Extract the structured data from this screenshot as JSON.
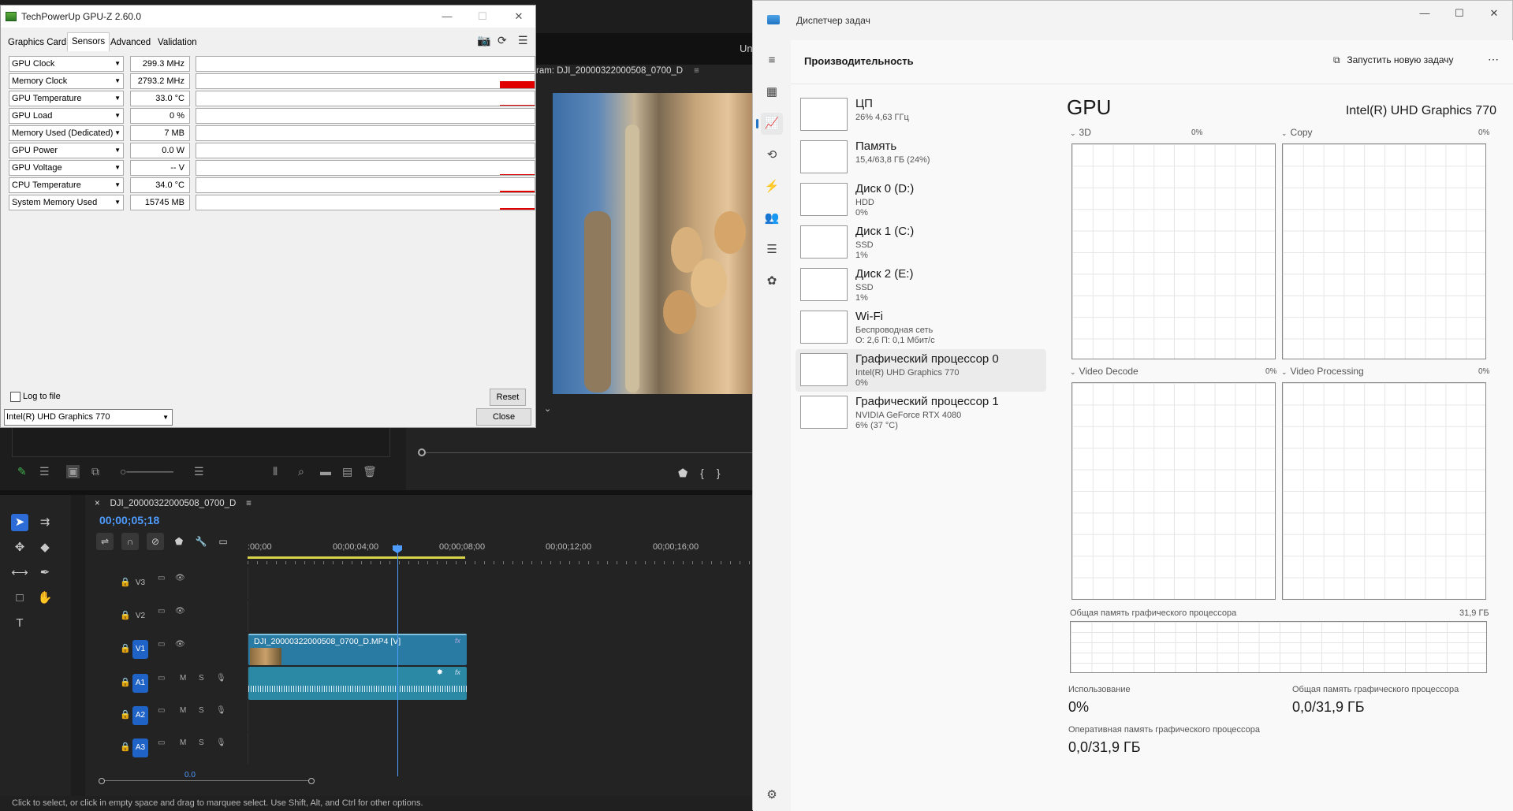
{
  "premiere": {
    "top_label": "Un",
    "program_tab": "ram: DJI_20000322000508_0700_D",
    "program_menu": "≡",
    "sequence_tab": "DJI_20000322000508_0700_D",
    "sequence_close": "×",
    "sequence_menu": "≡",
    "timecode": "00;00;05;18",
    "ruler_ticks": [
      ":00;00",
      "00;00;04;00",
      "00;00;08;00",
      "00;00;12;00",
      "00;00;16;00"
    ],
    "tracks": [
      {
        "label": "V3",
        "kind": "video",
        "active": false
      },
      {
        "label": "V2",
        "kind": "video",
        "active": false
      },
      {
        "label": "V1",
        "kind": "video",
        "active": true
      },
      {
        "label": "A1",
        "kind": "audio",
        "active": true
      },
      {
        "label": "A2",
        "kind": "audio",
        "active": true
      },
      {
        "label": "A3",
        "kind": "audio",
        "active": true
      }
    ],
    "audio_track_buttons": {
      "mute": "M",
      "solo": "S"
    },
    "clip_name": "DJI_20000322000508_0700_D.MP4 [V]",
    "clip_fx": "fx",
    "scroll_readout": "0.0",
    "status_text": "Click to select, or click in empty space and drag to marquee select. Use Shift, Alt, and Ctrl for other options."
  },
  "gpuz": {
    "title": "TechPowerUp GPU-Z 2.60.0",
    "tabs": [
      "Graphics Card",
      "Sensors",
      "Advanced",
      "Validation"
    ],
    "active_tab": "Sensors",
    "sensors": [
      {
        "name": "GPU Clock",
        "value": "299.3 MHz",
        "level": 0
      },
      {
        "name": "Memory Clock",
        "value": "2793.2 MHz",
        "level": 0.5
      },
      {
        "name": "GPU Temperature",
        "value": "33.0 °C",
        "level": 0.08
      },
      {
        "name": "GPU Load",
        "value": "0 %",
        "level": 0
      },
      {
        "name": "Memory Used (Dedicated)",
        "value": "7 MB",
        "level": 0
      },
      {
        "name": "GPU Power",
        "value": "0.0 W",
        "level": 0
      },
      {
        "name": "GPU Voltage",
        "value": "-- V",
        "level": 0.03
      },
      {
        "name": "CPU Temperature",
        "value": "34.0 °C",
        "level": 0.12
      },
      {
        "name": "System Memory Used",
        "value": "15745 MB",
        "level": 0.12
      }
    ],
    "log_to_file": "Log to file",
    "reset": "Reset",
    "gpu_select": "Intel(R) UHD Graphics 770",
    "close": "Close",
    "accent": "#e10000"
  },
  "taskmgr": {
    "title": "Диспетчер задач",
    "section": "Производительность",
    "run_task": "Запустить новую задачу",
    "perf_items": [
      {
        "name": "ЦП",
        "sub": [
          "26% 4,63 ГГц"
        ]
      },
      {
        "name": "Память",
        "sub": [
          "15,4/63,8 ГБ (24%)"
        ]
      },
      {
        "name": "Диск 0 (D:)",
        "sub": [
          "HDD",
          "0%"
        ]
      },
      {
        "name": "Диск 1 (C:)",
        "sub": [
          "SSD",
          "1%"
        ]
      },
      {
        "name": "Диск 2 (E:)",
        "sub": [
          "SSD",
          "1%"
        ]
      },
      {
        "name": "Wi-Fi",
        "sub": [
          "Беспроводная сеть",
          "О: 2,6 П: 0,1 Мбит/с"
        ]
      },
      {
        "name": "Графический процессор 0",
        "sub": [
          "Intel(R) UHD Graphics 770",
          "0%"
        ]
      },
      {
        "name": "Графический процессор 1",
        "sub": [
          "NVIDIA GeForce RTX 4080",
          "6% (37 °C)"
        ]
      }
    ],
    "selected_item": "Графический процессор 0",
    "gpu": {
      "title": "GPU",
      "model": "Intel(R) UHD Graphics 770",
      "graphs": [
        {
          "label": "3D",
          "pct": "0%"
        },
        {
          "label": "Copy",
          "pct": "0%"
        },
        {
          "label": "Video Decode",
          "pct": "0%"
        },
        {
          "label": "Video Processing",
          "pct": "0%"
        }
      ],
      "shared_mem_label": "Общая память графического процессора",
      "shared_mem_max": "31,9 ГБ",
      "stats": {
        "usage_label": "Использование",
        "usage_value": "0%",
        "shared_label": "Общая память графического процессора",
        "shared_value": "0,0/31,9 ГБ",
        "ram_label": "Оперативная память графического процессора",
        "ram_value": "0,0/31,9 ГБ"
      }
    },
    "accent": "#1f74c4"
  }
}
